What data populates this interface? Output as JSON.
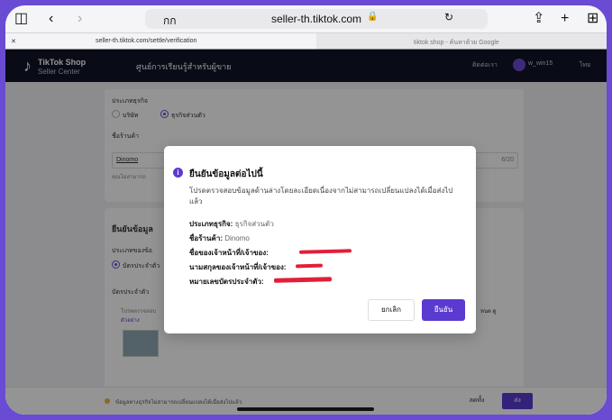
{
  "browser": {
    "tab_title": "กก",
    "url": "seller-th.tiktok.com",
    "tab1": "seller-th.tiktok.com/settle/verification",
    "tab2": "tiktok shop - ค้นหาด้วย Google"
  },
  "app": {
    "logo_text_1": "TikTok Shop",
    "logo_text_2": "Seller Center",
    "title": "ศูนย์การเรียนรู้สำหรับผู้ขาย",
    "contact": "ติดต่อเรา",
    "user": "w_win15",
    "language": "ไทย"
  },
  "form": {
    "business_type_label": "ประเภทธุรกิจ",
    "option_company": "บริษัท",
    "option_individual": "ธุรกิจส่วนตัว",
    "shop_name_label": "ชื่อร้านค้า",
    "shop_name_value": "Dinomo",
    "shop_name_counter": "6/20",
    "shop_name_hint": "คุณไม่สามารถ",
    "verify_title": "ยืนยันข้อมูล",
    "id_type_label": "ประเภทของข้อ",
    "id_option": "บัตรประจำตัว",
    "id_card_label": "บัตรประจำตัว",
    "id_card_hint": "โปรดตรวจสอบ",
    "example_link": "ตัวอย่าง",
    "hint_right": "หนด ดู"
  },
  "footer": {
    "note": "ข้อมูลทางธุรกิจไม่สามารถเปลี่ยนแปลงได้เมื่อส่งไปแล้ว",
    "save_label": "ลดทั้ง",
    "submit_label": "ส่ง"
  },
  "modal": {
    "title": "ยืนยันข้อมูลต่อไปนี้",
    "description": "โปรดตรวจสอบข้อมูลด้านล่างโดยละเอียดเนื่องจากไม่สามารถเปลี่ยนแปลงได้เมื่อส่งไปแล้ว",
    "business_type_label": "ประเภทธุรกิจ:",
    "business_type_value": "ธุรกิจส่วนตัว",
    "shop_name_label": "ชื่อร้านค้า:",
    "shop_name_value": "Dinomo",
    "owner_first_name_label": "ชื่อของเจ้าหน้าที่/เจ้าของ:",
    "owner_last_name_label": "นามสกุลของเจ้าหน้าที่/เจ้าของ:",
    "id_number_label": "หมายเลขบัตรประจำตัว:",
    "cancel_label": "ยกเลิก",
    "confirm_label": "ยืนยัน"
  },
  "colors": {
    "accent": "#5b3ad0",
    "appbar": "#101426",
    "redaction": "#e0203a"
  }
}
